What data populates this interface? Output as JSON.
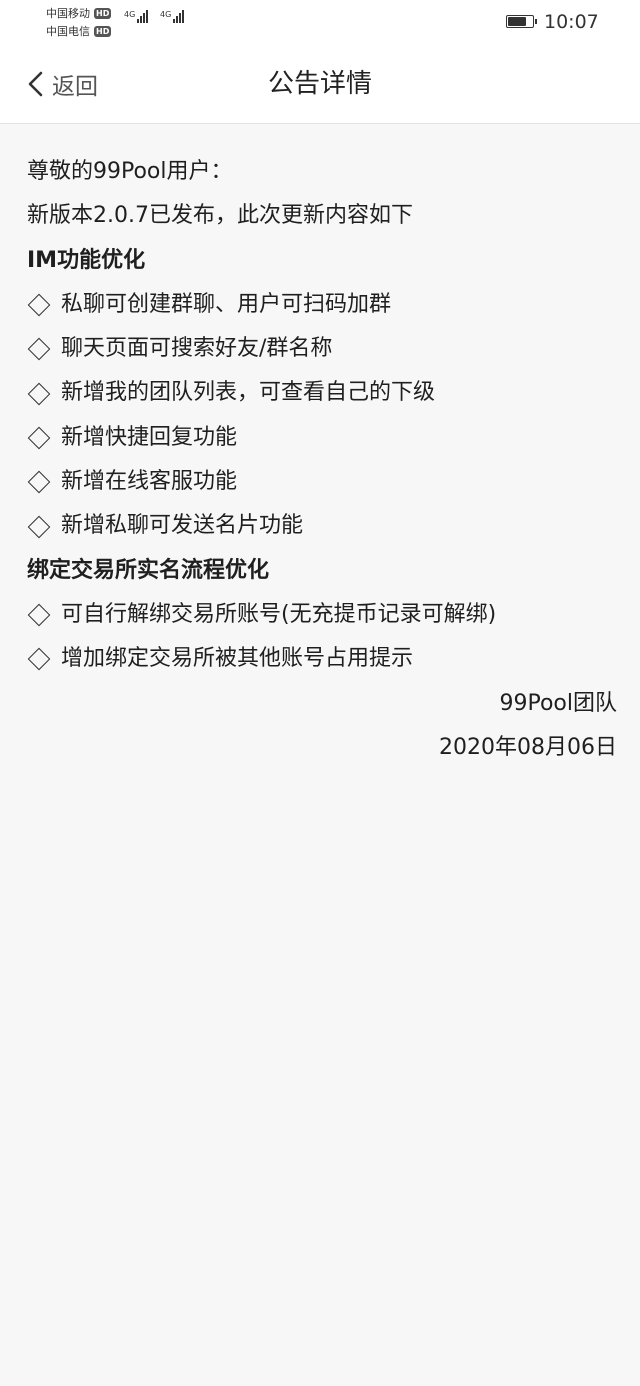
{
  "status_bar": {
    "carriers": [
      {
        "name": "中国移动",
        "badge": "HD"
      },
      {
        "name": "中国电信",
        "badge": "HD"
      }
    ],
    "signals": [
      {
        "label": "4G",
        "level": 4
      },
      {
        "label": "4G",
        "level": 4
      }
    ],
    "battery_level": 0.75,
    "time": "10:07"
  },
  "nav": {
    "back_label": "返回",
    "title": "公告详情"
  },
  "announcement": {
    "greeting": "尊敬的99Pool用户：",
    "intro": "新版本2.0.7已发布，此次更新内容如下",
    "sections": [
      {
        "title": "IM功能优化",
        "items": [
          "私聊可创建群聊、用户可扫码加群",
          "聊天页面可搜索好友/群名称",
          "新增我的团队列表，可查看自己的下级",
          "新增快捷回复功能",
          "新增在线客服功能",
          "新增私聊可发送名片功能"
        ]
      },
      {
        "title": "绑定交易所实名流程优化",
        "items": [
          "可自行解绑交易所账号(无充提币记录可解绑)",
          "增加绑定交易所被其他账号占用提示"
        ]
      }
    ],
    "signature": "99Pool团队",
    "date": "2020年08月06日"
  },
  "colors": {
    "page_bg": "#f7f7f7",
    "bar_bg": "#ffffff",
    "text": "#1f1f1f"
  }
}
